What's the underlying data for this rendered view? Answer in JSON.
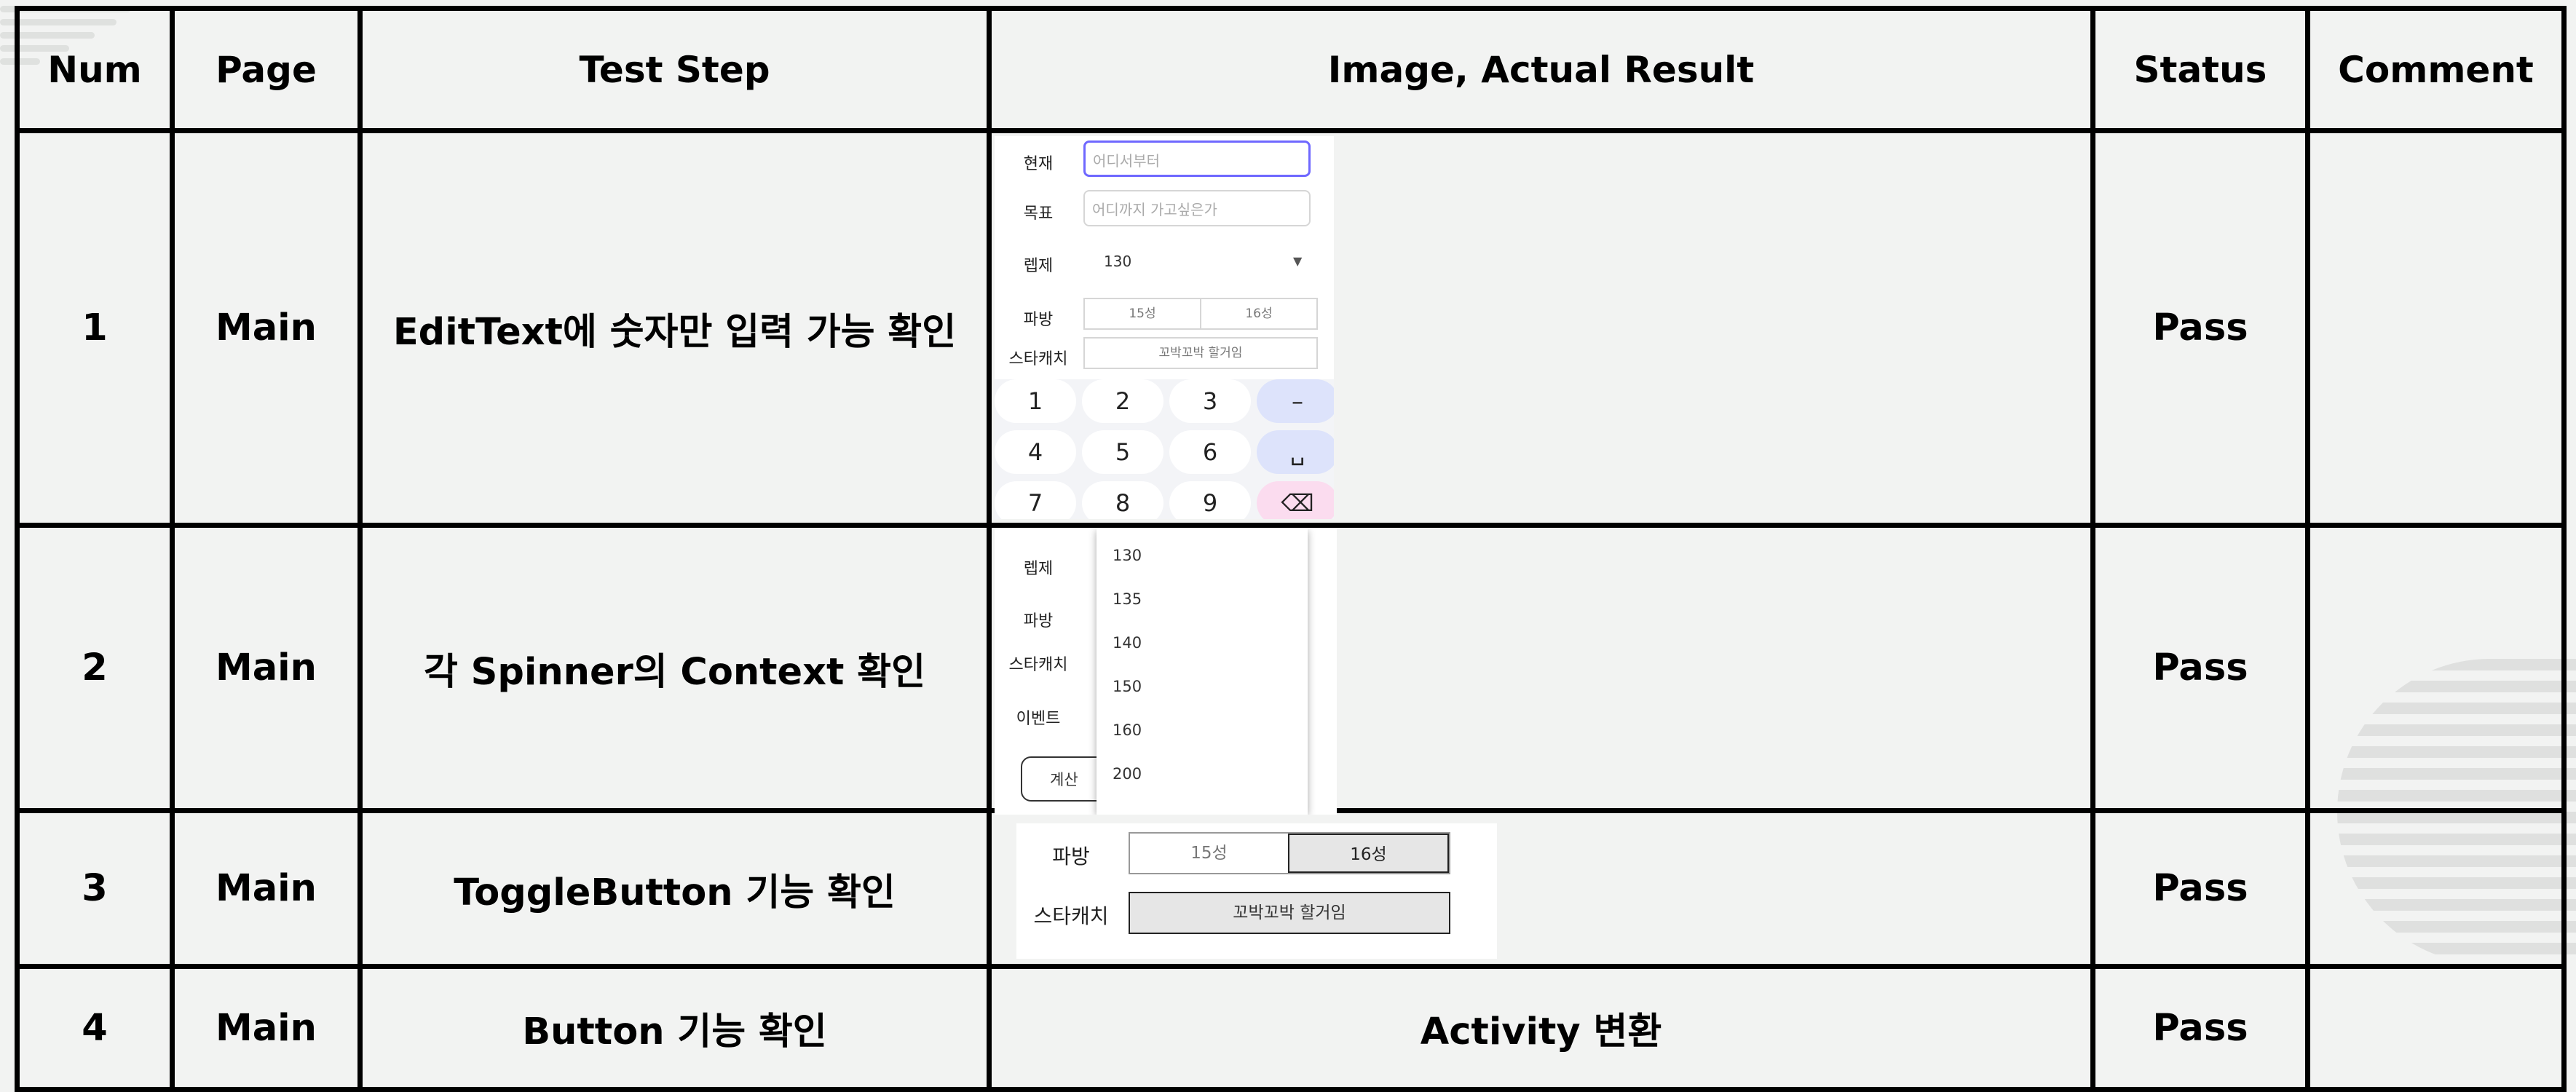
{
  "headers": [
    "Num",
    "Page",
    "Test Step",
    "Image, Actual Result",
    "Status",
    "Comment"
  ],
  "rows": [
    {
      "num": "1",
      "page": "Main",
      "step": "EditText에 숫자만 입력 가능 확인",
      "status": "Pass",
      "comment": ""
    },
    {
      "num": "2",
      "page": "Main",
      "step": "각 Spinner의 Context 확인",
      "status": "Pass",
      "comment": ""
    },
    {
      "num": "3",
      "page": "Main",
      "step": "ToggleButton 기능 확인",
      "status": "Pass",
      "comment": ""
    },
    {
      "num": "4",
      "page": "Main",
      "step": "Button 기능 확인",
      "result": "Activity 변환",
      "status": "Pass",
      "comment": ""
    }
  ],
  "shot1": {
    "current_label": "현재",
    "current_placeholder": "어디서부터",
    "target_label": "목표",
    "target_placeholder": "어디까지 가고싶은가",
    "level_label": "렙제",
    "level_value": "130",
    "fragment_label": "파방",
    "fragment_opt1": "15성",
    "fragment_opt2": "16성",
    "starcatch_label": "스타캐치",
    "starcatch_opt": "꼬박꼬박 할거임",
    "keys": [
      "1",
      "2",
      "3",
      "–",
      "4",
      "5",
      "6",
      "␣",
      "7",
      "8",
      "9",
      "⌫"
    ]
  },
  "shot2": {
    "level_label": "렙제",
    "fragment_label": "파방",
    "starcatch_label": "스타캐치",
    "event_label": "이벤트",
    "calc_label": "계산",
    "options": [
      "130",
      "135",
      "140",
      "150",
      "160",
      "200"
    ]
  },
  "shot3": {
    "fragment_label": "파방",
    "opt1": "15성",
    "opt2": "16성",
    "starcatch_label": "스타캐치",
    "starcatch_opt": "꼬박꼬박 할거임"
  },
  "colors": {
    "border": "#000000",
    "background": "#f2f3f2",
    "focus": "#6f68ff",
    "key_fn": "#dde3fb",
    "key_del": "#fbdcef"
  }
}
